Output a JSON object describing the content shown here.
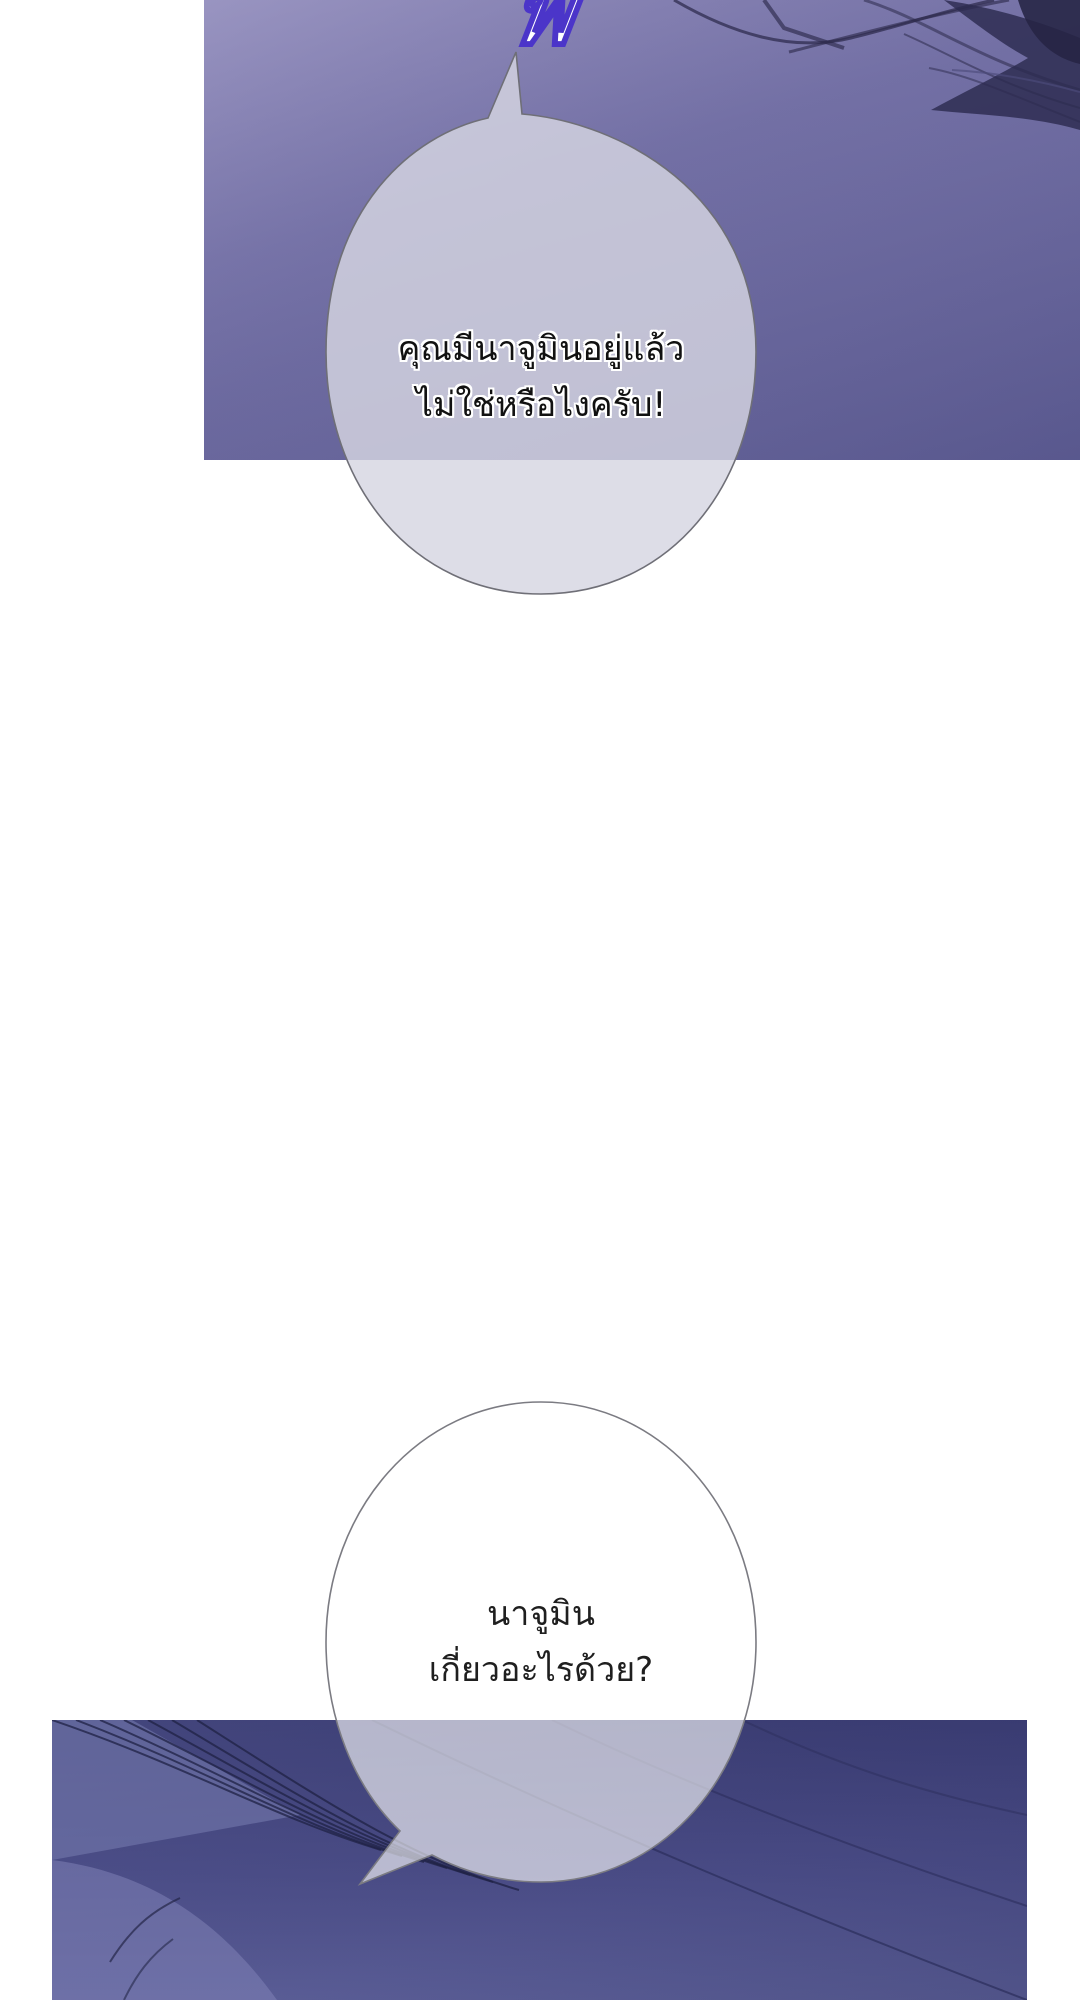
{
  "page": {
    "background": "#ffffff"
  },
  "panels": [
    {
      "id": "top",
      "colors": {
        "start": "#8d88b7",
        "mid": "#726fa4",
        "end": "#5c5b91"
      }
    },
    {
      "id": "bottom",
      "colors": {
        "start": "#383a70",
        "mid": "#4a4c86",
        "end": "#5c5f98"
      }
    }
  ],
  "sound_effect": {
    "text": "ฟึ",
    "fill": "#ffffff",
    "outline": "#4b35c9"
  },
  "speech_bubbles": [
    {
      "id": "bubble-1",
      "lines": [
        "คุณมีนาจูมินอยู่แล้ว",
        "ไม่ใช่หรือไงครับ!"
      ],
      "fill": "rgba(214,214,226,0.82)",
      "stroke": "#6f6f77"
    },
    {
      "id": "bubble-2",
      "lines": [
        "นาจูมิน",
        "เกี่ยวอะไรด้วย?"
      ],
      "fill": "rgba(255,255,255,0.62)",
      "stroke": "#7b7b82"
    }
  ]
}
